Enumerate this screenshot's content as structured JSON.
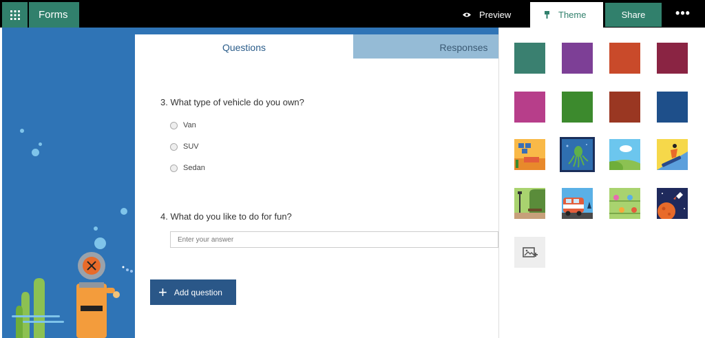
{
  "topbar": {
    "app_name": "Forms",
    "preview_label": "Preview",
    "theme_label": "Theme",
    "share_label": "Share",
    "more_label": "•••"
  },
  "tabs": {
    "questions": "Questions",
    "responses": "Responses"
  },
  "questions": [
    {
      "title": "3. What type of vehicle do you own?",
      "options": [
        "Van",
        "SUV",
        "Sedan"
      ]
    },
    {
      "title": "4. What do you like to do for fun?",
      "placeholder": "Enter your answer"
    }
  ],
  "add_question_label": "Add question",
  "theme_panel": {
    "colors": [
      "#3a8070",
      "#7d3f96",
      "#c94a2a",
      "#8a2443",
      "#b73e8a",
      "#3c8a2d",
      "#9a3722",
      "#1e4f8a"
    ],
    "image_themes": [
      "office-desk",
      "octopus-underwater",
      "cloud-hills",
      "snowboarder",
      "park-lamp",
      "camper-van",
      "science-flasks",
      "space-rocket"
    ],
    "selected": "octopus-underwater"
  }
}
